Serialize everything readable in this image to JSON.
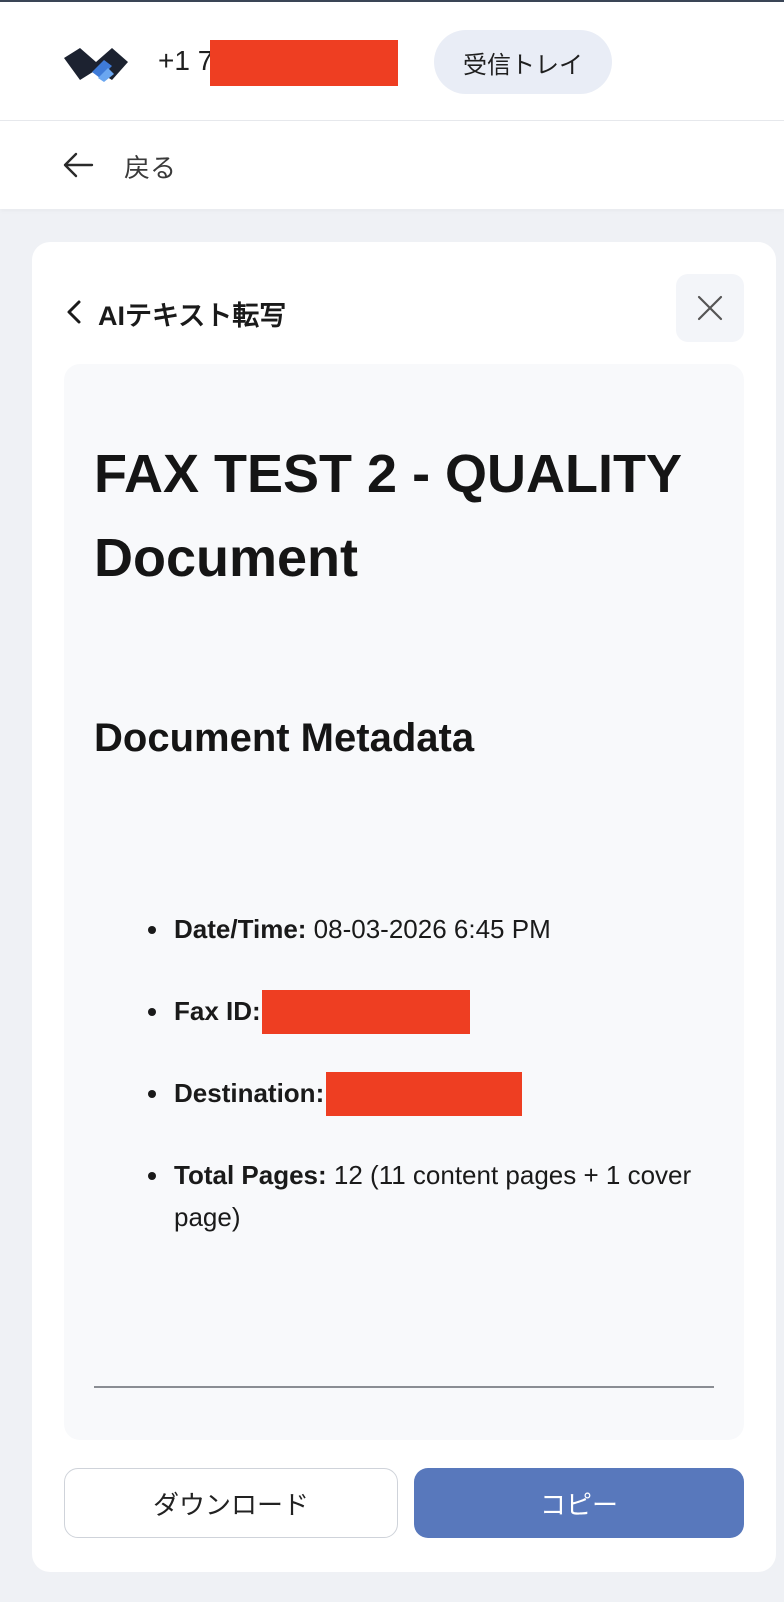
{
  "header": {
    "phone_prefix": "+1 7",
    "inbox_label": "受信トレイ"
  },
  "nav": {
    "back_label": "戻る"
  },
  "panel": {
    "title": "AIテキスト転写",
    "document": {
      "title": "FAX TEST 2 - QUALITY Document",
      "section_heading": "Document Metadata",
      "metadata": [
        {
          "label": "Date/Time:",
          "value": " 08-03-2026 6:45 PM"
        },
        {
          "label": "Fax ID:",
          "value": ""
        },
        {
          "label": "Destination:",
          "value": ""
        },
        {
          "label": "Total Pages:",
          "value": " 12 (11 content pages + 1 cover page)"
        }
      ]
    },
    "download_label": "ダウンロード",
    "copy_label": "コピー"
  },
  "colors": {
    "accent": "#5878bc",
    "redaction": "#ee3e22",
    "background": "#eff1f5"
  },
  "icons": [
    "brand-logo",
    "arrow-left-icon",
    "chevron-left-icon",
    "close-icon"
  ]
}
